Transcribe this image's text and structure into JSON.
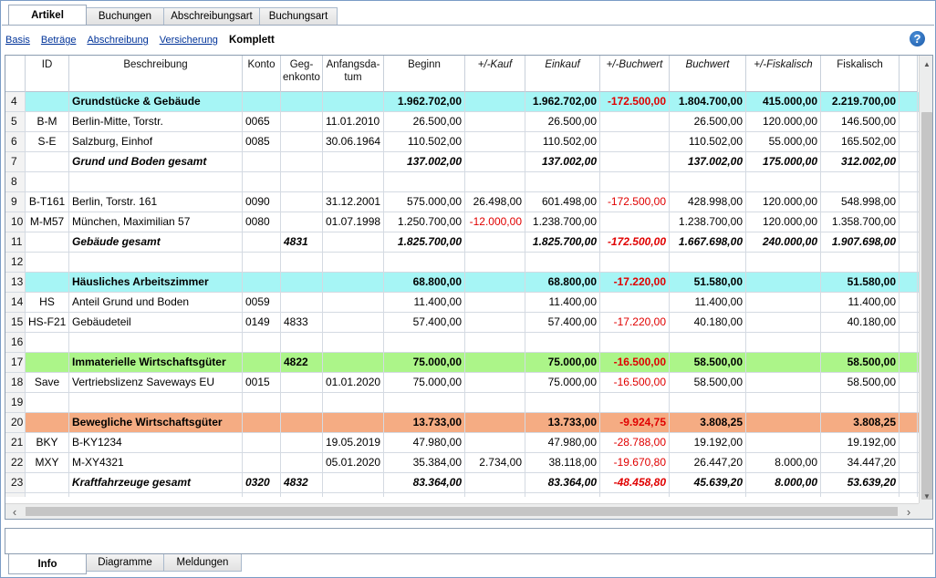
{
  "top_tabs": [
    "Artikel",
    "Buchungen",
    "Abschreibungsart",
    "Buchungsart"
  ],
  "subnav": {
    "links": [
      "Basis",
      "Beträge",
      "Abschreibung",
      "Versicherung"
    ],
    "current": "Komplett"
  },
  "help_symbol": "?",
  "columns": [
    "ID",
    "Beschreibung",
    "Konto",
    "Geg-\nenkonto",
    "Anfangsda-\ntum",
    "Beginn",
    "+/-Kauf",
    "Einkauf",
    "+/-Buchwert",
    "Buchwert",
    "+/-Fiskalisch",
    "Fiskalisch"
  ],
  "rows": [
    {
      "n": "4",
      "style": "cyan group",
      "cells": [
        "",
        "Grundstücke & Gebäude",
        "",
        "",
        "",
        "1.962.702,00",
        "",
        "1.962.702,00",
        "-172.500,00",
        "1.804.700,00",
        "415.000,00",
        "2.219.700,00"
      ]
    },
    {
      "n": "5",
      "style": "",
      "cells": [
        "B-M",
        "Berlin-Mitte, Torstr.",
        "0065",
        "",
        "11.01.2010",
        "26.500,00",
        "",
        "26.500,00",
        "",
        "26.500,00",
        "120.000,00",
        "146.500,00"
      ]
    },
    {
      "n": "6",
      "style": "",
      "cells": [
        "S-E",
        "Salzburg, Einhof",
        "0085",
        "",
        "30.06.1964",
        "110.502,00",
        "",
        "110.502,00",
        "",
        "110.502,00",
        "55.000,00",
        "165.502,00"
      ]
    },
    {
      "n": "7",
      "style": "sub",
      "cells": [
        "",
        "Grund und Boden gesamt",
        "",
        "",
        "",
        "137.002,00",
        "",
        "137.002,00",
        "",
        "137.002,00",
        "175.000,00",
        "312.002,00"
      ]
    },
    {
      "n": "8",
      "style": "",
      "cells": [
        "",
        "",
        "",
        "",
        "",
        "",
        "",
        "",
        "",
        "",
        "",
        ""
      ]
    },
    {
      "n": "9",
      "style": "",
      "cells": [
        "B-T161",
        "Berlin, Torstr. 161",
        "0090",
        "",
        "31.12.2001",
        "575.000,00",
        "26.498,00",
        "601.498,00",
        "-172.500,00",
        "428.998,00",
        "120.000,00",
        "548.998,00"
      ]
    },
    {
      "n": "10",
      "style": "",
      "cells": [
        "M-M57",
        "München, Maximilian 57",
        "0080",
        "",
        "01.07.1998",
        "1.250.700,00",
        "-12.000,00",
        "1.238.700,00",
        "",
        "1.238.700,00",
        "120.000,00",
        "1.358.700,00"
      ]
    },
    {
      "n": "11",
      "style": "sub",
      "cells": [
        "",
        "Gebäude gesamt",
        "",
        "4831",
        "",
        "1.825.700,00",
        "",
        "1.825.700,00",
        "-172.500,00",
        "1.667.698,00",
        "240.000,00",
        "1.907.698,00"
      ]
    },
    {
      "n": "12",
      "style": "",
      "cells": [
        "",
        "",
        "",
        "",
        "",
        "",
        "",
        "",
        "",
        "",
        "",
        ""
      ]
    },
    {
      "n": "13",
      "style": "cyan group",
      "cells": [
        "",
        "Häusliches Arbeitszimmer",
        "",
        "",
        "",
        "68.800,00",
        "",
        "68.800,00",
        "-17.220,00",
        "51.580,00",
        "",
        "51.580,00"
      ]
    },
    {
      "n": "14",
      "style": "",
      "cells": [
        "HS",
        "Anteil Grund und Boden",
        "0059",
        "",
        "",
        "11.400,00",
        "",
        "11.400,00",
        "",
        "11.400,00",
        "",
        "11.400,00"
      ]
    },
    {
      "n": "15",
      "style": "",
      "cells": [
        "HS-F21",
        "Gebäudeteil",
        "0149",
        "4833",
        "",
        "57.400,00",
        "",
        "57.400,00",
        "-17.220,00",
        "40.180,00",
        "",
        "40.180,00"
      ]
    },
    {
      "n": "16",
      "style": "",
      "cells": [
        "",
        "",
        "",
        "",
        "",
        "",
        "",
        "",
        "",
        "",
        "",
        ""
      ]
    },
    {
      "n": "17",
      "style": "green group",
      "cells": [
        "",
        "Immaterielle Wirtschaftsgüter",
        "",
        "4822",
        "",
        "75.000,00",
        "",
        "75.000,00",
        "-16.500,00",
        "58.500,00",
        "",
        "58.500,00"
      ]
    },
    {
      "n": "18",
      "style": "",
      "cells": [
        "Save",
        "Vertriebslizenz Saveways EU",
        "0015",
        "",
        "01.01.2020",
        "75.000,00",
        "",
        "75.000,00",
        "-16.500,00",
        "58.500,00",
        "",
        "58.500,00"
      ]
    },
    {
      "n": "19",
      "style": "",
      "cells": [
        "",
        "",
        "",
        "",
        "",
        "",
        "",
        "",
        "",
        "",
        "",
        ""
      ]
    },
    {
      "n": "20",
      "style": "orange group",
      "cells": [
        "",
        "Bewegliche Wirtschaftsgüter",
        "",
        "",
        "",
        "13.733,00",
        "",
        "13.733,00",
        "-9.924,75",
        "3.808,25",
        "",
        "3.808,25"
      ]
    },
    {
      "n": "21",
      "style": "",
      "cells": [
        "BKY",
        "B-KY1234",
        "",
        "",
        "19.05.2019",
        "47.980,00",
        "",
        "47.980,00",
        "-28.788,00",
        "19.192,00",
        "",
        "19.192,00"
      ]
    },
    {
      "n": "22",
      "style": "",
      "cells": [
        "MXY",
        "M-XY4321",
        "",
        "",
        "05.01.2020",
        "35.384,00",
        "2.734,00",
        "38.118,00",
        "-19.670,80",
        "26.447,20",
        "8.000,00",
        "34.447,20"
      ]
    },
    {
      "n": "23",
      "style": "sub",
      "cells": [
        "",
        "Kraftfahrzeuge gesamt",
        "0320",
        "4832",
        "",
        "83.364,00",
        "",
        "83.364,00",
        "-48.458,80",
        "45.639,20",
        "8.000,00",
        "53.639,20"
      ]
    },
    {
      "n": "24",
      "style": "",
      "cells": [
        "",
        "",
        "",
        "",
        "",
        "",
        "",
        "",
        "",
        "",
        "",
        ""
      ]
    }
  ],
  "bottom_tabs": [
    "Info",
    "Diagramme",
    "Meldungen"
  ]
}
